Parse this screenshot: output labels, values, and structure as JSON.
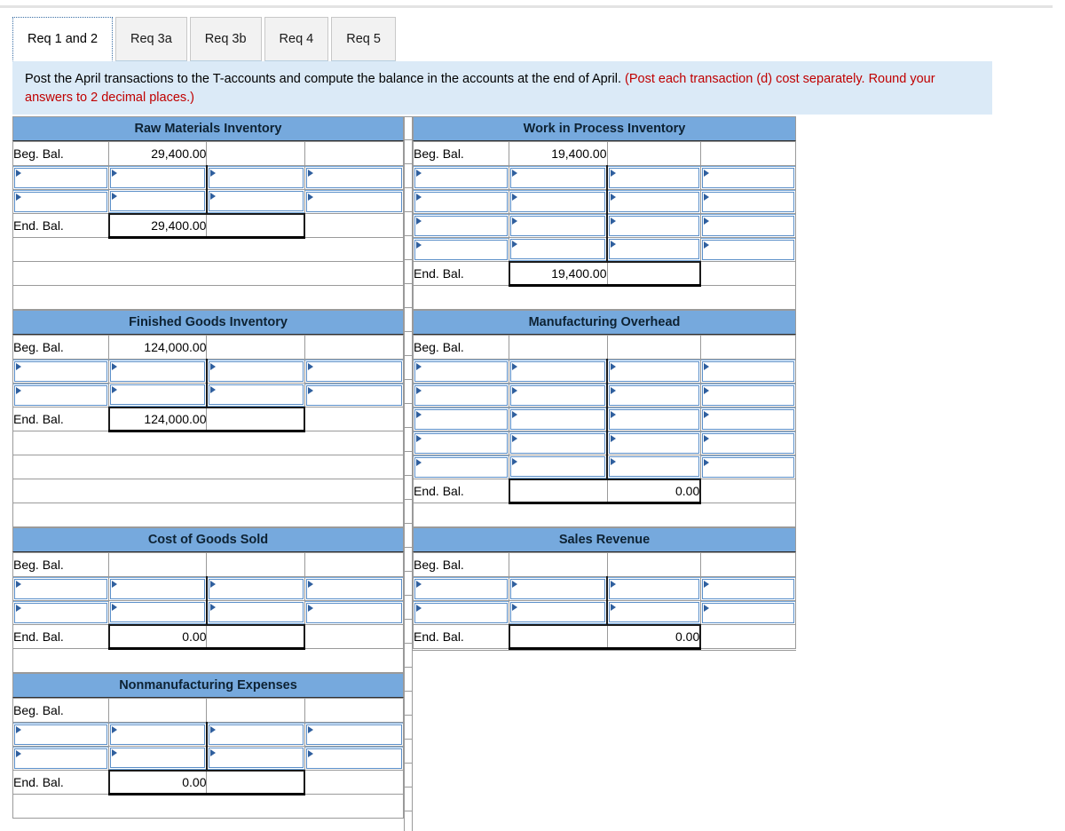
{
  "tabs": [
    {
      "label": "Req 1 and 2",
      "active": true
    },
    {
      "label": "Req 3a",
      "active": false
    },
    {
      "label": "Req 3b",
      "active": false
    },
    {
      "label": "Req 4",
      "active": false
    },
    {
      "label": "Req 5",
      "active": false
    }
  ],
  "instruction": {
    "main": "Post the April transactions to the T-accounts and compute the balance in the accounts at the end of April.",
    "hint": "(Post each transaction (d) cost separately. Round your answers to 2 decimal places.)"
  },
  "labels": {
    "beg_bal": "Beg. Bal.",
    "end_bal": "End. Bal."
  },
  "colors": {
    "header_blue": "#76a9dd",
    "banner_blue": "#dbeaf7",
    "hint_red": "#c00000",
    "field_border": "#5b8fc9",
    "marker_blue": "#2f5f9e"
  },
  "accounts": {
    "raw_materials": {
      "title": "Raw Materials Inventory",
      "beg_bal_debit": "29,400.00",
      "beg_bal_credit": "",
      "input_rows": 2,
      "end_bal_debit": "29,400.00",
      "end_bal_credit": "",
      "trailing_blank_rows": 3
    },
    "work_in_process": {
      "title": "Work in Process Inventory",
      "beg_bal_debit": "19,400.00",
      "beg_bal_credit": "",
      "input_rows": 4,
      "end_bal_debit": "19,400.00",
      "end_bal_credit": "",
      "trailing_blank_rows": 1
    },
    "finished_goods": {
      "title": "Finished Goods Inventory",
      "beg_bal_debit": "124,000.00",
      "beg_bal_credit": "",
      "input_rows": 2,
      "end_bal_debit": "124,000.00",
      "end_bal_credit": "",
      "trailing_blank_rows": 4
    },
    "manufacturing_overhead": {
      "title": "Manufacturing Overhead",
      "beg_bal_debit": "",
      "beg_bal_credit": "",
      "input_rows": 5,
      "end_bal_debit": "",
      "end_bal_credit": "0.00",
      "trailing_blank_rows": 1
    },
    "cost_of_goods_sold": {
      "title": "Cost of Goods Sold",
      "beg_bal_debit": "",
      "beg_bal_credit": "",
      "input_rows": 2,
      "end_bal_debit": "0.00",
      "end_bal_credit": "",
      "trailing_blank_rows": 1
    },
    "sales_revenue": {
      "title": "Sales Revenue",
      "beg_bal_debit": "",
      "beg_bal_credit": "",
      "input_rows": 2,
      "end_bal_debit": "",
      "end_bal_credit": "0.00",
      "trailing_blank_rows": 0
    },
    "nonmanufacturing_expenses": {
      "title": "Nonmanufacturing Expenses",
      "beg_bal_debit": "",
      "beg_bal_credit": "",
      "input_rows": 2,
      "end_bal_debit": "0.00",
      "end_bal_credit": "",
      "trailing_blank_rows": 1
    }
  }
}
